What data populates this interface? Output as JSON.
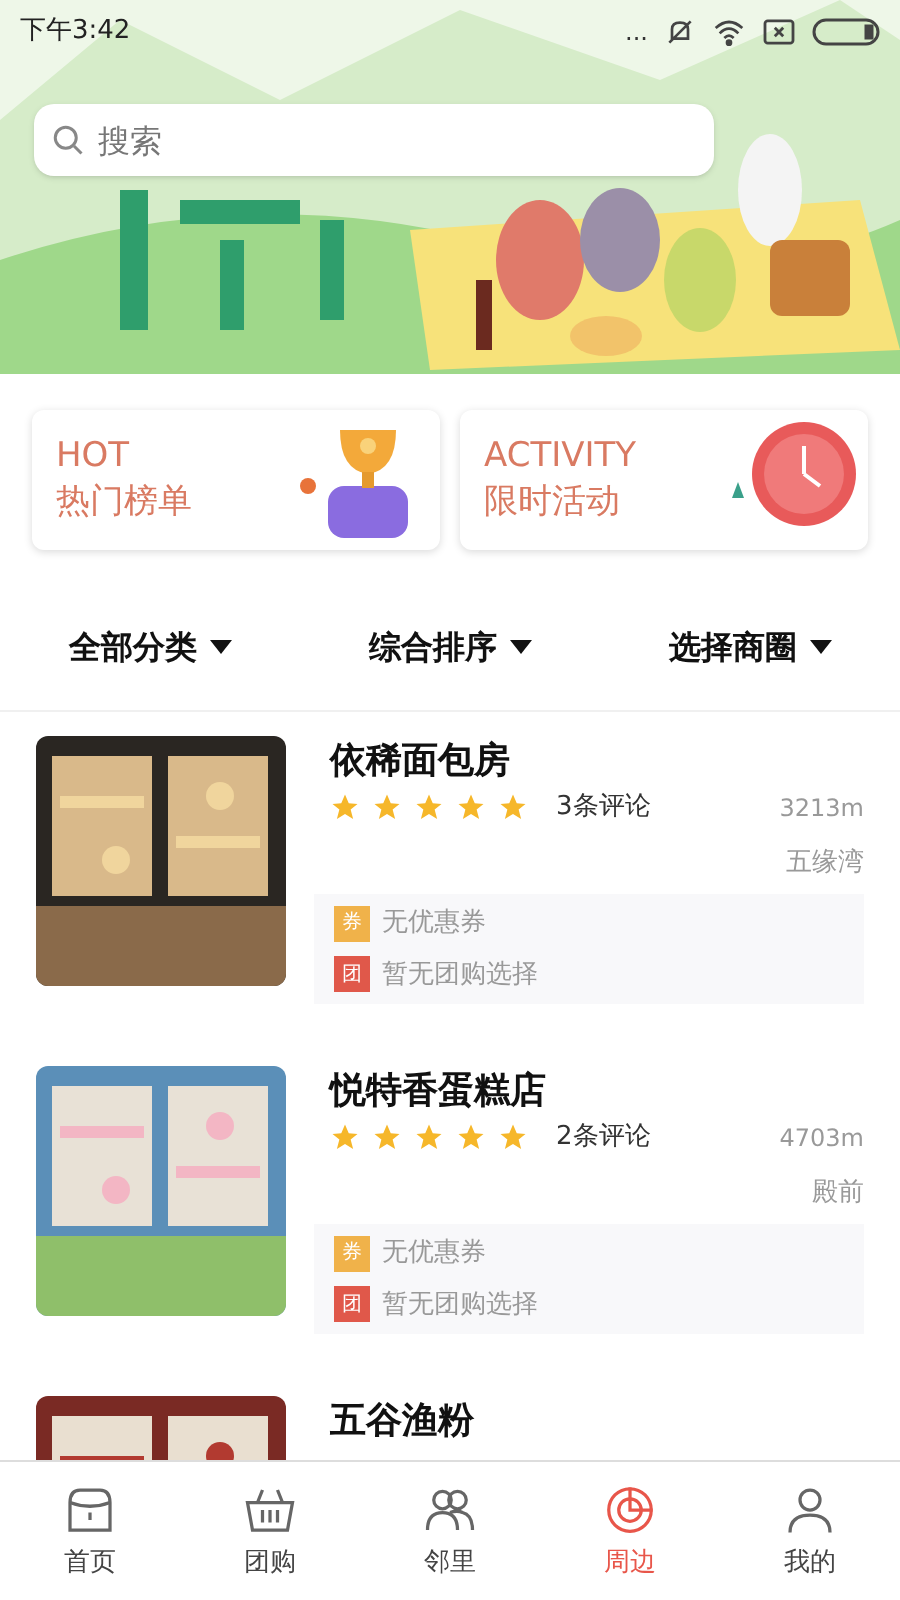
{
  "status_bar": {
    "time": "下午3:42",
    "dots": "..."
  },
  "search": {
    "placeholder": "搜索"
  },
  "promos": [
    {
      "kind": "hot",
      "title": "HOT",
      "subtitle": "热门榜单"
    },
    {
      "kind": "activity",
      "title": "ACTIVITY",
      "subtitle": "限时活动"
    }
  ],
  "filters": [
    {
      "label": "全部分类"
    },
    {
      "label": "综合排序"
    },
    {
      "label": "选择商圈"
    }
  ],
  "shops": [
    {
      "name": "依稀面包房",
      "stars": 5,
      "reviews": "3条评论",
      "distance": "3213m",
      "area": "五缘湾",
      "coupon_badge": "券",
      "coupon": "无优惠券",
      "group_badge": "团",
      "group": "暂无团购选择"
    },
    {
      "name": "悦特香蛋糕店",
      "stars": 5,
      "reviews": "2条评论",
      "distance": "4703m",
      "area": "殿前",
      "coupon_badge": "券",
      "coupon": "无优惠券",
      "group_badge": "团",
      "group": "暂无团购选择"
    },
    {
      "name": "五谷渔粉"
    }
  ],
  "tabs": [
    {
      "kind": "home",
      "label": "首页",
      "selected": false
    },
    {
      "kind": "basket",
      "label": "团购",
      "selected": false
    },
    {
      "kind": "people",
      "label": "邻里",
      "selected": false
    },
    {
      "kind": "target",
      "label": "周边",
      "selected": true
    },
    {
      "kind": "person",
      "label": "我的",
      "selected": false
    }
  ]
}
